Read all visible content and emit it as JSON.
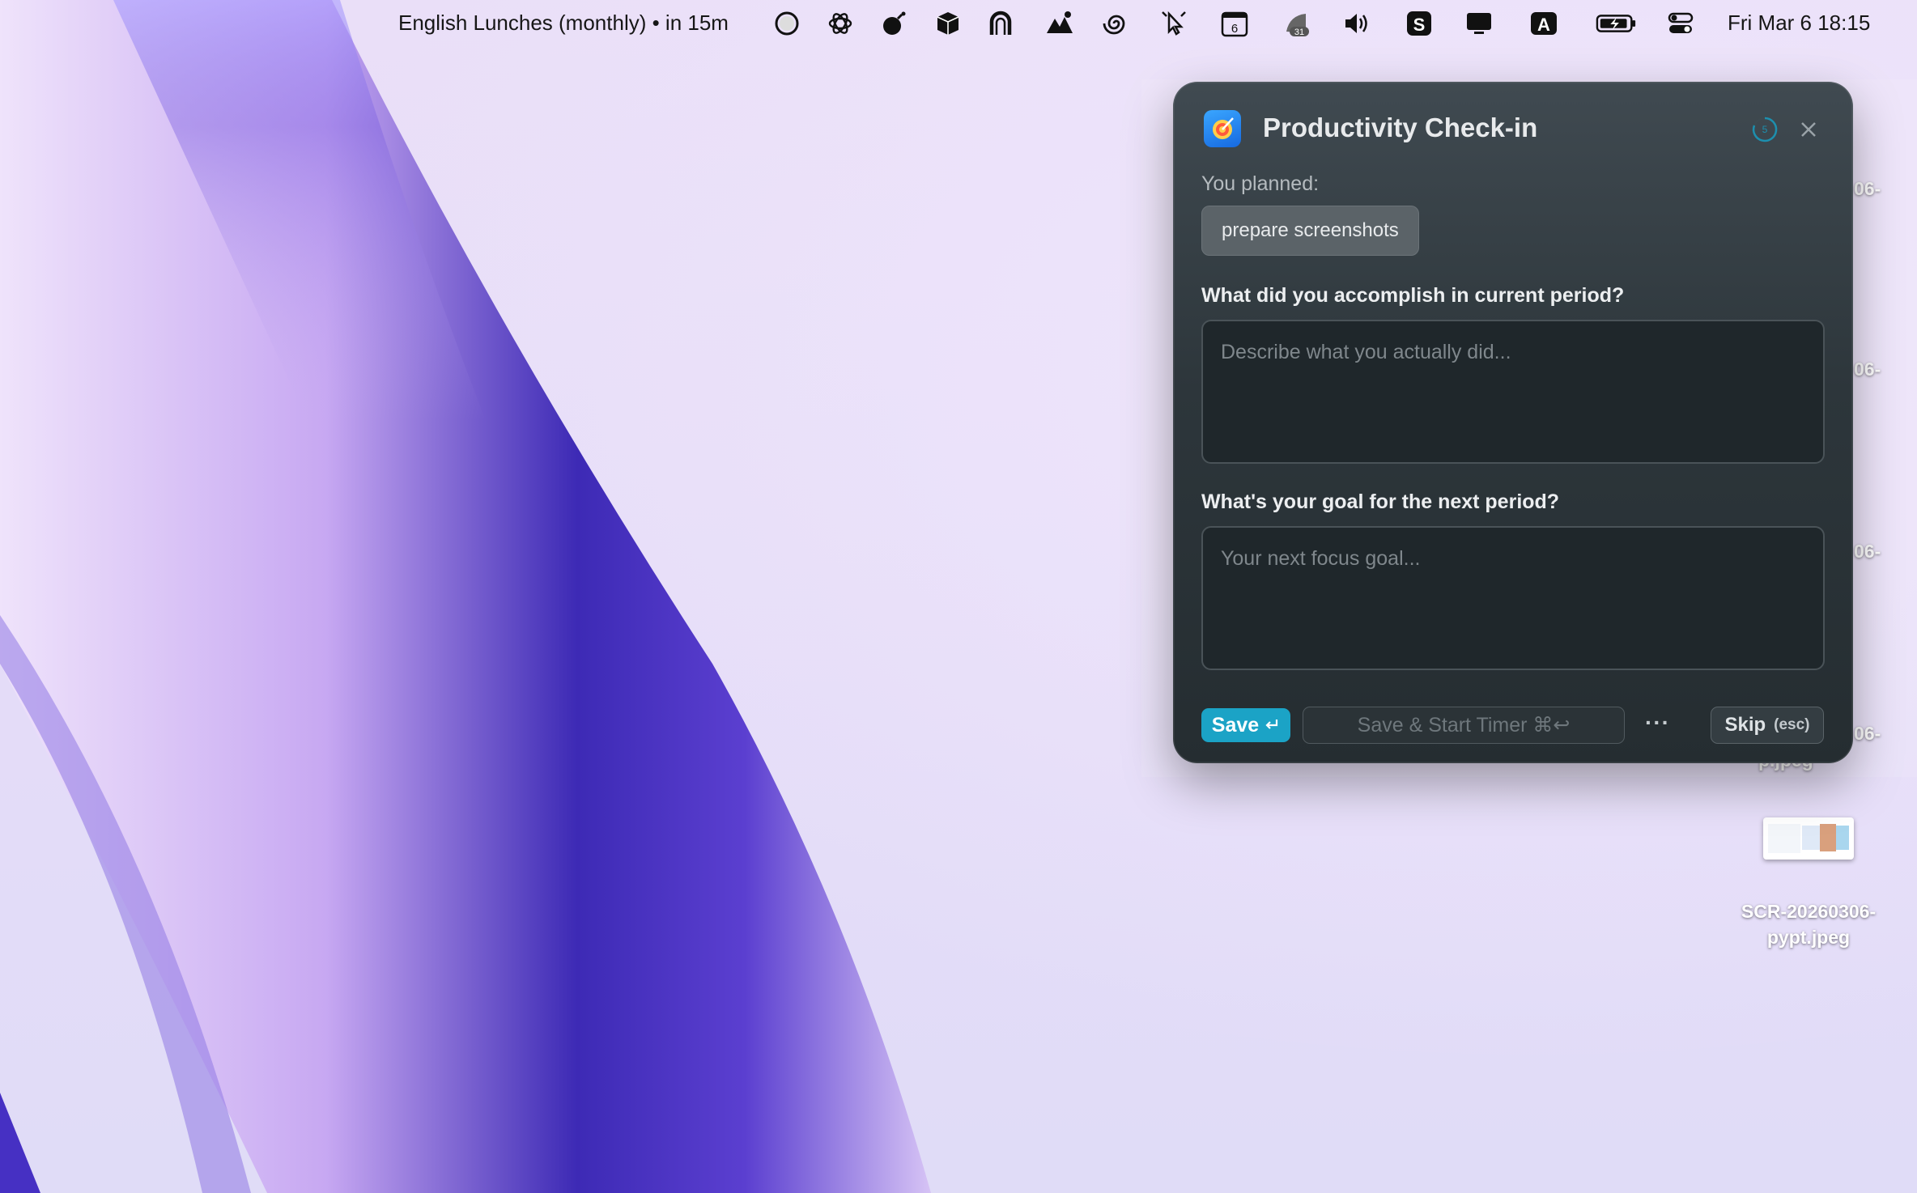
{
  "menubar": {
    "event": "English Lunches (monthly) • in 15m",
    "calendar_day": "6",
    "focus_badge": "31",
    "clock": "Fri Mar 6  18:15",
    "icons": [
      "circle-icon",
      "openai-icon",
      "bomb-icon",
      "box-icon",
      "horseshoe-icon",
      "mountains-icon",
      "spiral-icon",
      "cursor-icon",
      "calendar-icon",
      "fan-icon",
      "volume-icon",
      "s-app-icon",
      "display-icon",
      "keyboard-input-icon",
      "battery-icon",
      "control-center-icon"
    ]
  },
  "desktop": {
    "file_label_line1": "SCR-20260306-",
    "file_label_line2": "pypt.jpeg",
    "partial_labels": [
      "06-",
      "06-",
      "06-",
      "06-"
    ],
    "partial_sub": "p.jpeg"
  },
  "popup": {
    "title": "Productivity Check-in",
    "timer_value": "5",
    "planned_label": "You planned:",
    "planned_value": "prepare screenshots",
    "q1": "What did you accomplish in current period?",
    "q1_placeholder": "Describe what you actually did...",
    "q2": "What's your goal for the next period?",
    "q2_placeholder": "Your next focus goal...",
    "save_label": "Save",
    "save_start_label": "Save & Start Timer ⌘↩",
    "more_label": "···",
    "skip_label": "Skip",
    "skip_key": "(esc)"
  },
  "colors": {
    "accent": "#1ba3c6",
    "popup_bg": "#2d363b"
  }
}
